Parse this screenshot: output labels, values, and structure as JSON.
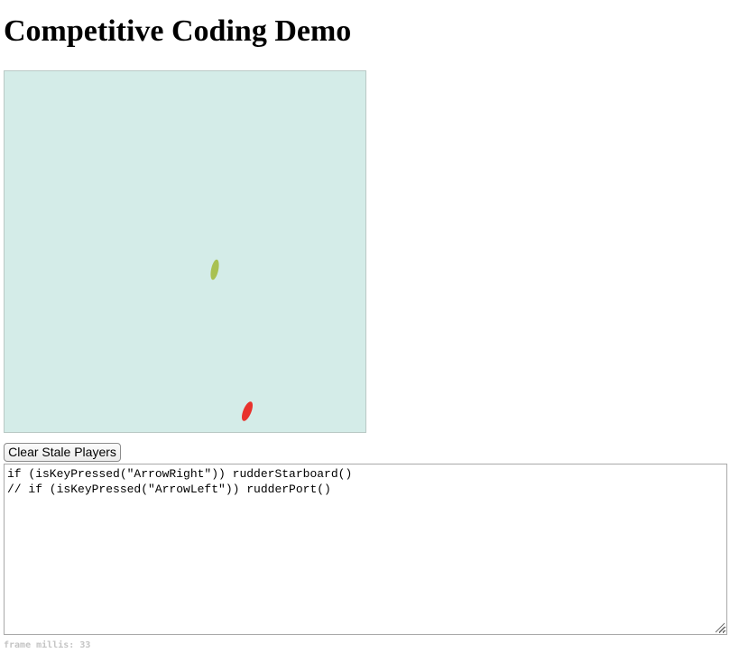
{
  "page": {
    "title": "Competitive Coding Demo"
  },
  "game": {
    "background_color": "#d4ece8",
    "players": [
      {
        "name": "green-player",
        "color": "#a9c152"
      },
      {
        "name": "red-player",
        "color": "#e8322c"
      }
    ]
  },
  "controls": {
    "clear_button_label": "Clear Stale Players"
  },
  "editor": {
    "code": "if (isKeyPressed(\"ArrowRight\")) rudderStarboard()\n// if (isKeyPressed(\"ArrowLeft\")) rudderPort()"
  },
  "status": {
    "frame_millis_label": "frame millis:",
    "frame_millis_value": "33"
  }
}
